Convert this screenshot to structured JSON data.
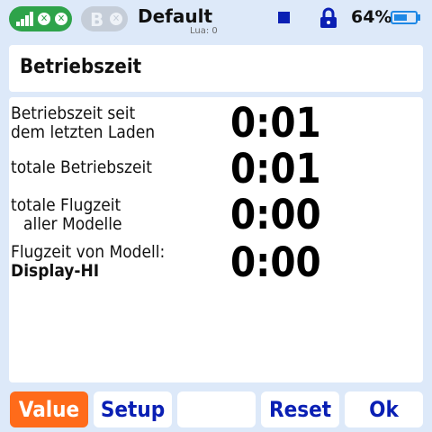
{
  "topbar": {
    "model_name": "Default",
    "lua_label": "Lua: 0",
    "battery_percent_text": "64%",
    "battery_level": 0.64,
    "bt_letter": "B",
    "icons": [
      "signal-icon",
      "close-icon",
      "close-icon",
      "bluetooth-icon",
      "close-icon",
      "lock-icon",
      "battery-icon"
    ],
    "colors": {
      "rf_pill": "#2ea34a",
      "accent_blue": "#0a1fb4",
      "battery": "#1e88e5",
      "background": "#dde9f9"
    }
  },
  "page": {
    "title": "Betriebszeit"
  },
  "rows": [
    {
      "label_line1": "Betriebszeit seit",
      "label_line2": "dem letzten Laden",
      "value": "0:01"
    },
    {
      "label_line1": "totale Betriebszeit",
      "label_line2": "",
      "value": "0:01"
    },
    {
      "label_line1": "totale Flugzeit",
      "label_line2": "aller Modelle",
      "value": "0:00"
    },
    {
      "label_line1": "Flugzeit von Modell:",
      "label_line2": "Display-HI",
      "value": "0:00"
    }
  ],
  "buttons": {
    "value": "Value",
    "setup": "Setup",
    "empty": "",
    "reset": "Reset",
    "ok": "Ok",
    "active_color": "#ff6b1a"
  }
}
